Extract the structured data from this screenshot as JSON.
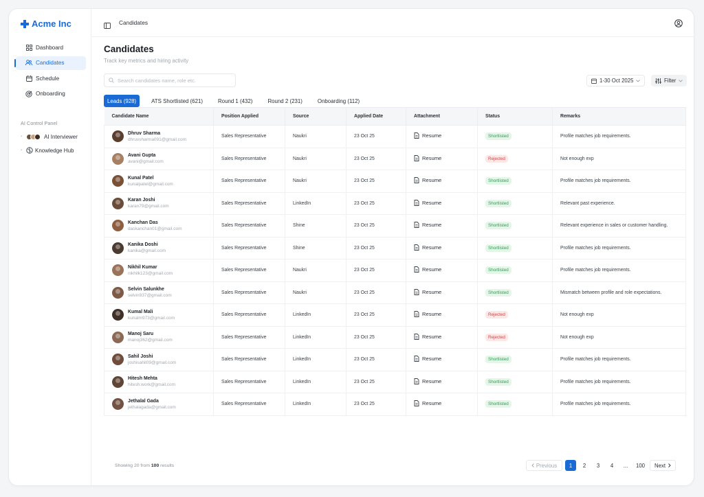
{
  "brand": {
    "name": "Acme Inc",
    "color": "#1a6ad6"
  },
  "sidebar": {
    "items": [
      {
        "label": "Dashboard",
        "icon": "grid-icon"
      },
      {
        "label": "Candidates",
        "icon": "users-icon"
      },
      {
        "label": "Schedule",
        "icon": "calendar-icon"
      },
      {
        "label": "Onboarding",
        "icon": "target-icon"
      }
    ],
    "section_title": "AI Control Panel",
    "ai_items": [
      {
        "label": "AI Interviewer",
        "icon": "avatar-stack"
      },
      {
        "label": "Knowledge Hub",
        "icon": "brain-icon"
      }
    ]
  },
  "topbar": {
    "breadcrumb": "Candidates"
  },
  "page": {
    "title": "Candidates",
    "subtitle": "Track key metrics and hiring activity",
    "search_placeholder": "Search candidates name, role etc.",
    "date_range": "1-30 Oct 2025",
    "filter_label": "Filter"
  },
  "tabs": [
    {
      "label": "Leads (928)"
    },
    {
      "label": "ATS Shortlisted (621)"
    },
    {
      "label": "Round 1 (432)"
    },
    {
      "label": "Round 2 (231)"
    },
    {
      "label": "Onboarding (112)"
    }
  ],
  "table": {
    "headers": [
      "Candidate Name",
      "Position Applied",
      "Source",
      "Applied Date",
      "Attachment",
      "Status",
      "Remarks"
    ],
    "rows": [
      {
        "name": "Dhruv Sharma",
        "email": "dhruvsharma091@gmail.com",
        "position": "Sales Representative",
        "source": "Naukri",
        "date": "23 Oct 25",
        "attachment": "Resume",
        "status": "Shortlisted",
        "remarks": "Profile matches job requirements."
      },
      {
        "name": "Avani Gupta",
        "email": "avani@gmail.com",
        "position": "Sales Representative",
        "source": "Naukri",
        "date": "23 Oct 25",
        "attachment": "Resume",
        "status": "Rejected",
        "remarks": "Not enough exp"
      },
      {
        "name": "Kunal Patel",
        "email": "kunalpatel@gmail.com",
        "position": "Sales Representative",
        "source": "Naukri",
        "date": "23 Oct 25",
        "attachment": "Resume",
        "status": "Shortlisted",
        "remarks": "Profile matches job requirements."
      },
      {
        "name": "Karan Joshi",
        "email": "karan79@gmail.com",
        "position": "Sales Representative",
        "source": "LinkedIn",
        "date": "23 Oct 25",
        "attachment": "Resume",
        "status": "Shortlisted",
        "remarks": "Relevant past experience."
      },
      {
        "name": "Kanchan Das",
        "email": "daskanchan01@gmail.com",
        "position": "Sales Representative",
        "source": "Shine",
        "date": "23 Oct 25",
        "attachment": "Resume",
        "status": "Shortlisted",
        "remarks": "Relevant experience in sales or customer handling."
      },
      {
        "name": "Kanika Doshi",
        "email": "kanika@gmail.com",
        "position": "Sales Representative",
        "source": "Shine",
        "date": "23 Oct 25",
        "attachment": "Resume",
        "status": "Shortlisted",
        "remarks": "Profile matches job requirements."
      },
      {
        "name": "Nikhil Kumar",
        "email": "nikhilk123@gmail.com",
        "position": "Sales Representative",
        "source": "Naukri",
        "date": "23 Oct 25",
        "attachment": "Resume",
        "status": "Shortlisted",
        "remarks": "Profile matches job requirements."
      },
      {
        "name": "Selvin Salunkhe",
        "email": "selvin937@gmail.com",
        "position": "Sales Representative",
        "source": "Naukri",
        "date": "23 Oct 25",
        "attachment": "Resume",
        "status": "Shortlisted",
        "remarks": "Mismatch between profile and role expectations."
      },
      {
        "name": "Kumal Mali",
        "email": "kunalm973@gmail.com",
        "position": "Sales Representative",
        "source": "LinkedIn",
        "date": "23 Oct 25",
        "attachment": "Resume",
        "status": "Rejected",
        "remarks": "Not enough exp"
      },
      {
        "name": "Manoj Saru",
        "email": "manoj362@gmail.com",
        "position": "Sales Representative",
        "source": "LinkedIn",
        "date": "23 Oct 25",
        "attachment": "Resume",
        "status": "Rejected",
        "remarks": "Not enough exp"
      },
      {
        "name": "Sahil Joshi",
        "email": "joshisahil09@gmail.com",
        "position": "Sales Representative",
        "source": "LinkedIn",
        "date": "23 Oct 25",
        "attachment": "Resume",
        "status": "Shortlisted",
        "remarks": "Profile matches job requirements."
      },
      {
        "name": "Hitesh Mehta",
        "email": "hitesh.work@gmail.com",
        "position": "Sales Representative",
        "source": "LinkedIn",
        "date": "23 Oct 25",
        "attachment": "Resume",
        "status": "Shortlisted",
        "remarks": "Profile matches job requirements."
      },
      {
        "name": "Jethalal Gada",
        "email": "jethalagada@gmail.com",
        "position": "Sales Representative",
        "source": "LinkedIn",
        "date": "23 Oct 25",
        "attachment": "Resume",
        "status": "Shortlisted",
        "remarks": "Profile matches job requirements."
      }
    ]
  },
  "footer": {
    "showing_prefix": "Showing 20 from",
    "total": "100",
    "showing_suffix": "results"
  },
  "pagination": {
    "prev": "Previous",
    "next": "Next",
    "pages": [
      "1",
      "2",
      "3",
      "4",
      "...",
      "100"
    ],
    "current": "1"
  },
  "colors": {
    "shortlisted_bg": "#e3f6e8",
    "shortlisted_fg": "#2f9e55",
    "rejected_bg": "#fde8e8",
    "rejected_fg": "#d14545"
  }
}
